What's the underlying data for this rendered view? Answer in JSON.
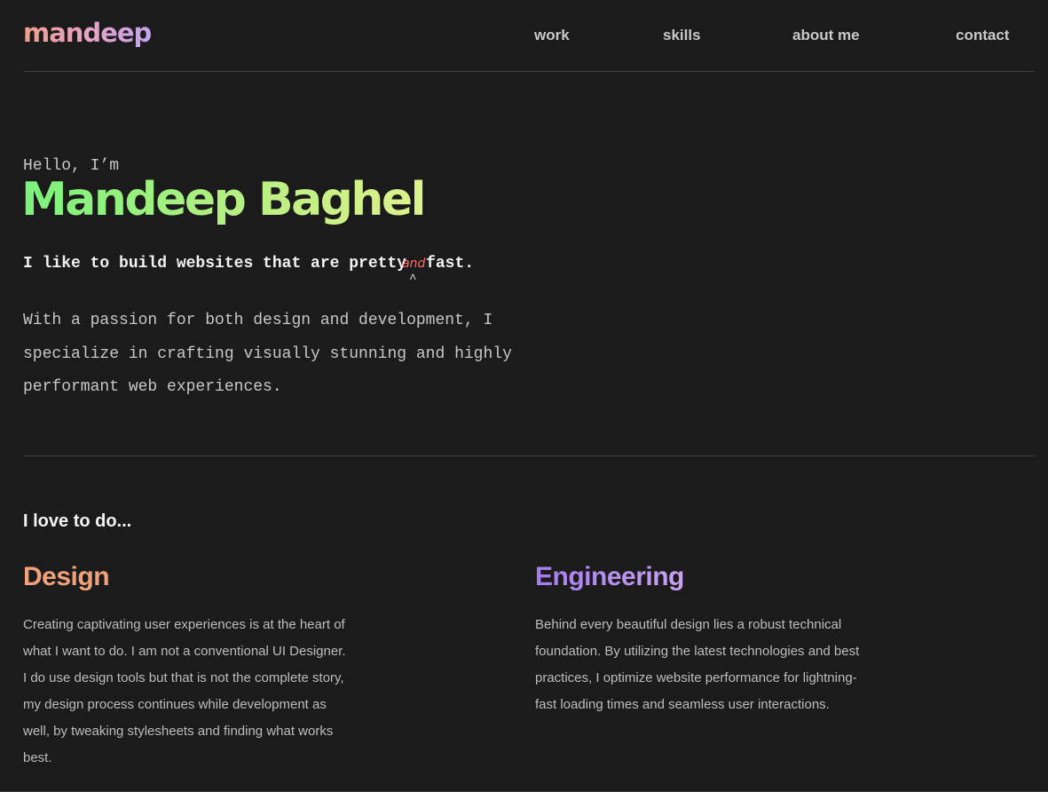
{
  "header": {
    "logo": "mandeep",
    "nav": [
      "work",
      "skills",
      "about me",
      "contact"
    ]
  },
  "hero": {
    "greeting": "Hello, I’m",
    "name": "Mandeep Baghel",
    "tagline_before": "I like to build websites that are pretty",
    "tagline_insert": "and",
    "tagline_caret": "^",
    "tagline_after": "fast.",
    "intro": "With a passion for both design and development, I specialize in crafting visually stunning and highly performant web experiences."
  },
  "skills": {
    "heading": "I love to do...",
    "items": [
      {
        "title": "Design",
        "description": "Creating captivating user experiences is at the heart of what I want to do. I am not a conventional UI Designer. I do use design tools but that is not the complete story, my design process continues while development as well, by tweaking stylesheets and finding what works best."
      },
      {
        "title": "Engineering",
        "description": "Behind every beautiful design lies a robust technical foundation. By utilizing the latest technologies and best practices, I optimize website performance for lightning-fast loading times and seamless user interactions."
      }
    ]
  },
  "colors": {
    "background": "#1b1b1b",
    "name_gradient": [
      "#7af27c",
      "#def28b"
    ],
    "logo_gradient": [
      "#f09f8b",
      "#c2a2f0"
    ],
    "design_accent": "#f2a27b",
    "engineering_accent": "#a57cf0",
    "annotation": "#ff6b6b"
  }
}
